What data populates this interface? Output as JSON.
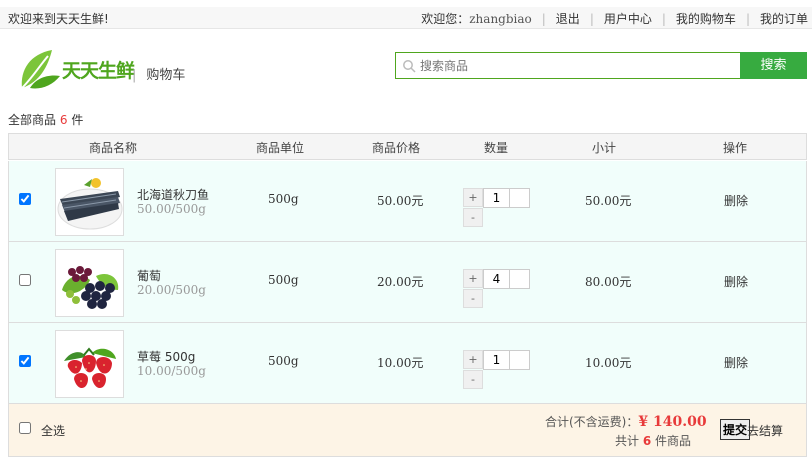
{
  "topbar": {
    "welcome": "欢迎来到天天生鲜!",
    "greeting": "欢迎您：",
    "username": "zhangbiao",
    "links": [
      "退出",
      "用户中心",
      "我的购物车",
      "我的订单"
    ]
  },
  "header": {
    "logo_text": "天天生鲜",
    "page_title": "购物车",
    "search_placeholder": "搜索商品",
    "search_button": "搜索"
  },
  "summary": {
    "label_prefix": "全部商品",
    "count": "6",
    "label_suffix": "件"
  },
  "table": {
    "columns": [
      "商品名称",
      "商品单位",
      "商品价格",
      "数量",
      "小计",
      "操作"
    ],
    "rows": [
      {
        "checked": true,
        "name": "北海道秋刀鱼",
        "unit_price": "50.00/500g",
        "unit": "500g",
        "price": "50.00元",
        "qty": "1",
        "subtotal": "50.00元",
        "action": "删除",
        "image": "saury-fish"
      },
      {
        "checked": false,
        "name": "葡萄",
        "unit_price": "20.00/500g",
        "unit": "500g",
        "price": "20.00元",
        "qty": "4",
        "subtotal": "80.00元",
        "action": "删除",
        "image": "grapes"
      },
      {
        "checked": true,
        "name": "草莓 500g",
        "unit_price": "10.00/500g",
        "unit": "500g",
        "price": "10.00元",
        "qty": "1",
        "subtotal": "10.00元",
        "action": "删除",
        "image": "strawberries"
      }
    ],
    "plus": "+",
    "minus": "-"
  },
  "footer": {
    "select_all": "全选",
    "total_label": "合计(不含运费)：",
    "total_amount": "¥ 140.00",
    "count_prefix": "共计",
    "count": "6",
    "count_suffix": "件商品",
    "submit_button": "提交",
    "checkout_text": "去结算"
  },
  "colors": {
    "brand_green": "#37ab40",
    "price_red": "#e83a3a",
    "row_bg": "#f1fefb",
    "footer_bg": "#fdf4e6"
  }
}
